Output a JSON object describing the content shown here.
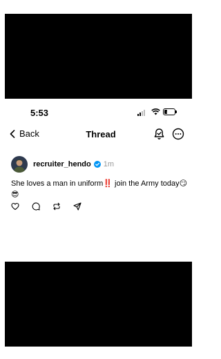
{
  "status_bar": {
    "time": "5:53",
    "battery": "28",
    "battery_level": 0.28
  },
  "nav": {
    "back_label": "Back",
    "title": "Thread"
  },
  "post": {
    "username": "recruiter_hendo",
    "timestamp": "1m",
    "text_part1": "She loves a man in uniform",
    "emoji_alarm": "‼️",
    "text_part2": " join the Army today",
    "emoji_1": "😏",
    "emoji_2": "😎"
  },
  "icons": {
    "back": "chevron-left-icon",
    "notify": "bell-check-icon",
    "more": "more-icon",
    "verified": "verified-badge-icon",
    "like": "heart-icon",
    "reply": "comment-icon",
    "repost": "repost-icon",
    "share": "send-icon"
  },
  "colors": {
    "verified": "#0095f6",
    "muted": "#999999",
    "alarm": "#d62020"
  }
}
